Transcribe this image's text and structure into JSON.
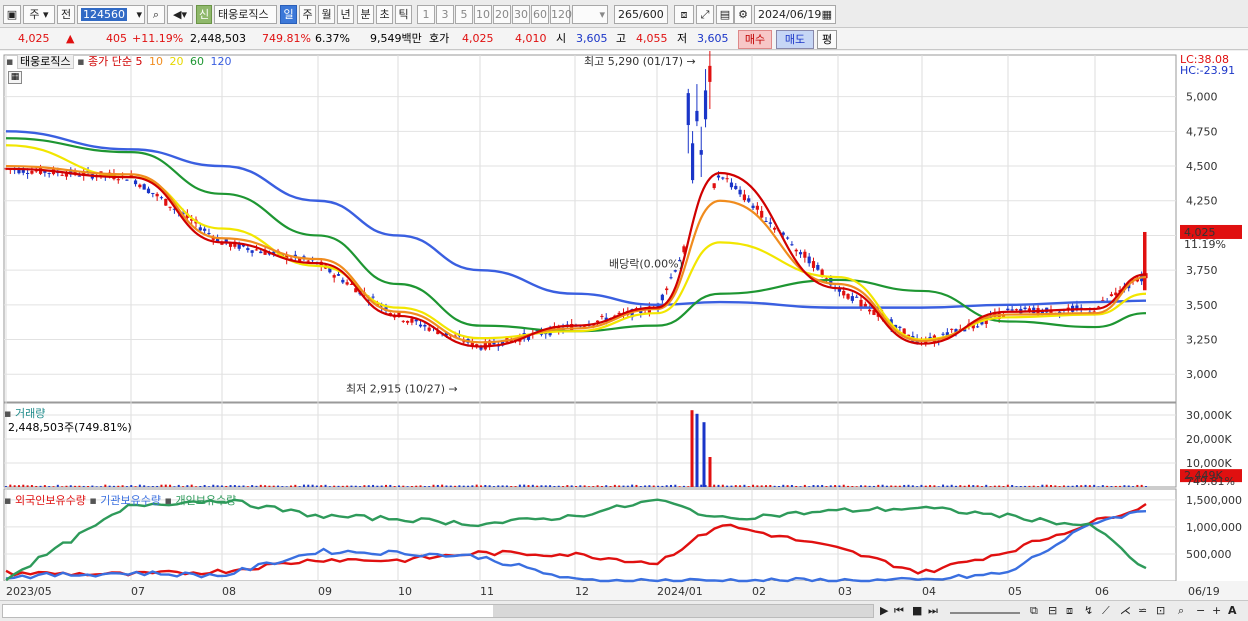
{
  "toolbar": {
    "stock_type": "주",
    "prev_label": "전",
    "code": "124560",
    "shin_badge": "신",
    "stock_name": "태웅로직스",
    "periods": [
      "일",
      "주",
      "월",
      "년",
      "분",
      "초",
      "틱"
    ],
    "intervals": [
      "1",
      "3",
      "5",
      "10",
      "20",
      "30",
      "60",
      "120"
    ],
    "count": "265",
    "count_max": "/600",
    "date": "2024/06/19"
  },
  "quote": {
    "price": "4,025",
    "change_arrow": "▲",
    "change": "405",
    "change_pct": "+11.19%",
    "volume": "2,448,503",
    "volume_ratio": "749.81%",
    "turnover": "6.37%",
    "amount": "9,549백만",
    "hoga_label": "호가",
    "ask": "4,025",
    "bid": "4,010",
    "open_label": "시",
    "open": "3,605",
    "high_label": "고",
    "high": "4,055",
    "low_label": "저",
    "low": "3,605",
    "buy_label": "매수",
    "sell_label": "매도",
    "eval_label": "평"
  },
  "price_pane": {
    "legend_name": "태웅로직스",
    "legend_ma_title": "종가 단순",
    "ma_periods": [
      "5",
      "10",
      "20",
      "60",
      "120"
    ],
    "lc_label": "LC:38.08",
    "hc_label": "HC:-23.91",
    "high_annotation": "최고 5,290 (01/17)",
    "low_annotation": "최저 2,915 (10/27)",
    "exdiv_annotation": "배당락(0.00%)",
    "current_price_tag": "4,025",
    "current_pct_tag": "11.19%"
  },
  "volume_pane": {
    "title": "거래량",
    "value_text": "2,448,503주(749.81%)",
    "tag_value": "2,449K",
    "tag_pct": "749.81%"
  },
  "holdings_pane": {
    "titles": [
      "외국인보유수량",
      "기관보유수량",
      "개인보유수량"
    ]
  },
  "x_axis": {
    "labels": [
      "2023/05",
      "07",
      "08",
      "09",
      "10",
      "11",
      "12",
      "2024/01",
      "02",
      "03",
      "04",
      "05",
      "06"
    ],
    "right_label": "06/19"
  },
  "colors": {
    "up": "#e01010",
    "down": "#1a35c8",
    "ma5": "#d00000",
    "ma10": "#f08c1e",
    "ma20": "#f2e600",
    "ma60": "#1e9632",
    "ma120": "#3a5fe0",
    "foreign": "#e01010",
    "institution": "#3a6fe0",
    "individual": "#2e9a5a"
  },
  "chart_data": [
    {
      "type": "line",
      "title": "태웅로직스",
      "ylim": [
        2800,
        5300
      ],
      "y_ticks": [
        3000,
        3250,
        3500,
        3750,
        4000,
        4250,
        4500,
        4750,
        5000
      ],
      "x": [
        "2023/05",
        "07",
        "08",
        "09",
        "10",
        "11",
        "12",
        "2024/01",
        "02",
        "03",
        "04",
        "05",
        "06",
        "06/19"
      ],
      "series": [
        {
          "name": "5",
          "values": [
            4480,
            4420,
            3950,
            3800,
            3420,
            3200,
            3350,
            3480,
            4450,
            3620,
            3220,
            3450,
            3470,
            3720
          ]
        },
        {
          "name": "10",
          "values": [
            4500,
            4440,
            3980,
            3830,
            3450,
            3230,
            3330,
            3470,
            4250,
            3650,
            3240,
            3430,
            3440,
            3700
          ]
        },
        {
          "name": "20",
          "values": [
            4650,
            4420,
            4050,
            3780,
            3480,
            3260,
            3310,
            3440,
            3950,
            3700,
            3250,
            3410,
            3430,
            3580
          ]
        },
        {
          "name": "60",
          "values": [
            4700,
            4600,
            4300,
            4000,
            3650,
            3350,
            3310,
            3350,
            3580,
            3680,
            3600,
            3380,
            3340,
            3440
          ]
        },
        {
          "name": "120",
          "values": [
            4750,
            4620,
            4500,
            4250,
            4000,
            3750,
            3580,
            3500,
            3520,
            3480,
            3480,
            3500,
            3520,
            3530
          ]
        }
      ],
      "annotations": [
        "최고 5,290 (01/17)",
        "최저 2,915 (10/27)",
        "배당락(0.00%)"
      ]
    },
    {
      "type": "bar",
      "title": "거래량",
      "ylim": [
        0,
        35000
      ],
      "y_ticks": [
        "10,000K",
        "20,000K",
        "30,000K"
      ],
      "peak_values_k": [
        32000,
        30500,
        27000,
        12500
      ],
      "last_value_k": 2449
    },
    {
      "type": "line",
      "title": "외국인보유수량 기관보유수량 개인보유수량",
      "ylim": [
        0,
        1700000
      ],
      "y_ticks": [
        "500,000",
        "1,000,000",
        "1,500,000"
      ],
      "x": [
        "2023/05",
        "07",
        "08",
        "09",
        "10",
        "11",
        "12",
        "2024/01",
        "02",
        "03",
        "04",
        "05",
        "06",
        "06/19"
      ],
      "series": [
        {
          "name": "외국인보유수량",
          "values": [
            150000,
            120000,
            180000,
            400000,
            380000,
            520000,
            490000,
            330000,
            1050000,
            600000,
            150000,
            550000,
            1100000,
            1400000
          ]
        },
        {
          "name": "기관보유수량",
          "values": [
            80000,
            150000,
            100000,
            550000,
            520000,
            450000,
            10000,
            10000,
            10000,
            10000,
            10000,
            150000,
            1100000,
            1300000
          ]
        },
        {
          "name": "개인보유수량",
          "values": [
            50000,
            1400000,
            1500000,
            1200000,
            1150000,
            1050000,
            1200000,
            1500000,
            1150000,
            1300000,
            1350000,
            1200000,
            1000000,
            200000
          ]
        }
      ]
    }
  ]
}
